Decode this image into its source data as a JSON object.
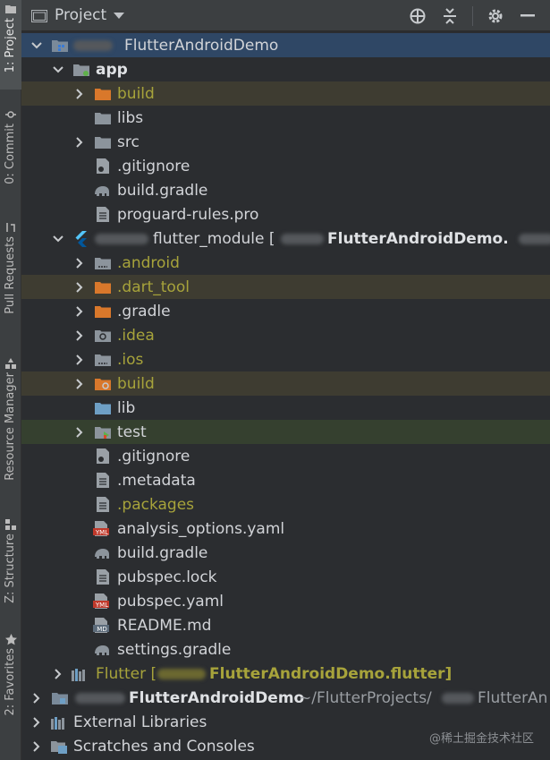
{
  "toolstrip": {
    "project": "1: Project",
    "commit": "0: Commit",
    "pull_requests": "Pull Requests",
    "resource_manager": "Resource Manager",
    "structure": "Z: Structure",
    "favorites": "2: Favorites"
  },
  "header": {
    "title": "Project"
  },
  "tree": {
    "root_name": "FlutterAndroidDemo",
    "app": "app",
    "app_build": "build",
    "libs": "libs",
    "src": "src",
    "app_gitignore": ".gitignore",
    "app_build_gradle": "build.gradle",
    "proguard": "proguard-rules.pro",
    "module_name": "flutter_module [",
    "module_project": "FlutterAndroidDemo.",
    "android": ".android",
    "dart_tool": ".dart_tool",
    "gradle": ".gradle",
    "idea": ".idea",
    "ios": ".ios",
    "module_build": "build",
    "lib": "lib",
    "test": "test",
    "mod_gitignore": ".gitignore",
    "metadata": ".metadata",
    "packages": ".packages",
    "analysis": "analysis_options.yaml",
    "mod_build_gradle": "build.gradle",
    "pubspec_lock": "pubspec.lock",
    "pubspec_yaml": "pubspec.yaml",
    "readme": "README.md",
    "settings_gradle": "settings.gradle",
    "flutter_prefix": "Flutter [",
    "flutter_project": "FlutterAndroidDemo.flutter]",
    "second_root": "FlutterAndroidDemo",
    "second_root_path": "~/FlutterProjects/",
    "second_root_path_tail": "FlutterAn",
    "external_libraries": "External Libraries",
    "scratches": "Scratches and Consoles"
  },
  "watermark": "@稀土掘金技术社区",
  "colors": {
    "background": "#2b2d30",
    "selected_row": "#2f4765",
    "excluded_row": "#3e3c31",
    "folder_blue": "#6e9fc5",
    "folder_orange": "#d9782b",
    "olive_text": "#a7a33b"
  }
}
